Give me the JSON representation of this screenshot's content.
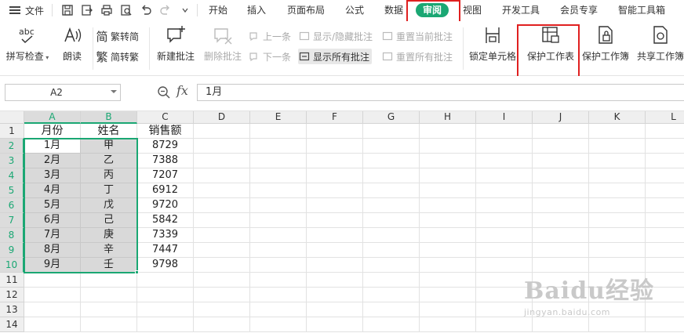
{
  "menubar": {
    "file_label": "文件",
    "tabs": [
      "开始",
      "插入",
      "页面布局",
      "公式",
      "数据",
      "审阅",
      "视图",
      "开发工具",
      "会员专享",
      "智能工具箱"
    ],
    "active_tab": "审阅"
  },
  "ribbon": {
    "spell_check": "拼写检查",
    "read_aloud": "朗读",
    "trad_to_simp": "繁转简",
    "simp_to_trad": "简转繁",
    "new_comment": "新建批注",
    "delete_comment": "删除批注",
    "prev_comment": "上一条",
    "next_comment": "下一条",
    "show_hide_comment": "显示/隐藏批注",
    "show_all_comments": "显示所有批注",
    "reset_current_comment": "重置当前批注",
    "reset_all_comments": "重置所有批注",
    "lock_cell": "锁定单元格",
    "protect_sheet": "保护工作表",
    "protect_workbook": "保护工作簿",
    "share_workbook": "共享工作簿",
    "abc_icon_text": "abc"
  },
  "formula_bar": {
    "name_box": "A2",
    "fx_label": "fx",
    "content": "1月"
  },
  "grid": {
    "columns": [
      "A",
      "B",
      "C",
      "D",
      "E",
      "F",
      "G",
      "H",
      "I",
      "J",
      "K",
      "L"
    ],
    "rows": [
      "1",
      "2",
      "3",
      "4",
      "5",
      "6",
      "7",
      "8",
      "9",
      "10",
      "11",
      "12",
      "13",
      "14"
    ],
    "header_row": [
      "月份",
      "姓名",
      "销售额"
    ],
    "data": [
      [
        "1月",
        "甲",
        "8729"
      ],
      [
        "2月",
        "乙",
        "7388"
      ],
      [
        "3月",
        "丙",
        "7207"
      ],
      [
        "4月",
        "丁",
        "6912"
      ],
      [
        "5月",
        "戊",
        "9720"
      ],
      [
        "6月",
        "己",
        "5842"
      ],
      [
        "7月",
        "庚",
        "7339"
      ],
      [
        "8月",
        "辛",
        "7447"
      ],
      [
        "9月",
        "壬",
        "9798"
      ]
    ]
  },
  "watermark": {
    "brand": "Baidu经验",
    "url": "jingyan.baidu.com"
  },
  "colors": {
    "accent_green": "#1aa773",
    "highlight_red": "#e02020",
    "selection_gray": "#d9d9d9"
  }
}
